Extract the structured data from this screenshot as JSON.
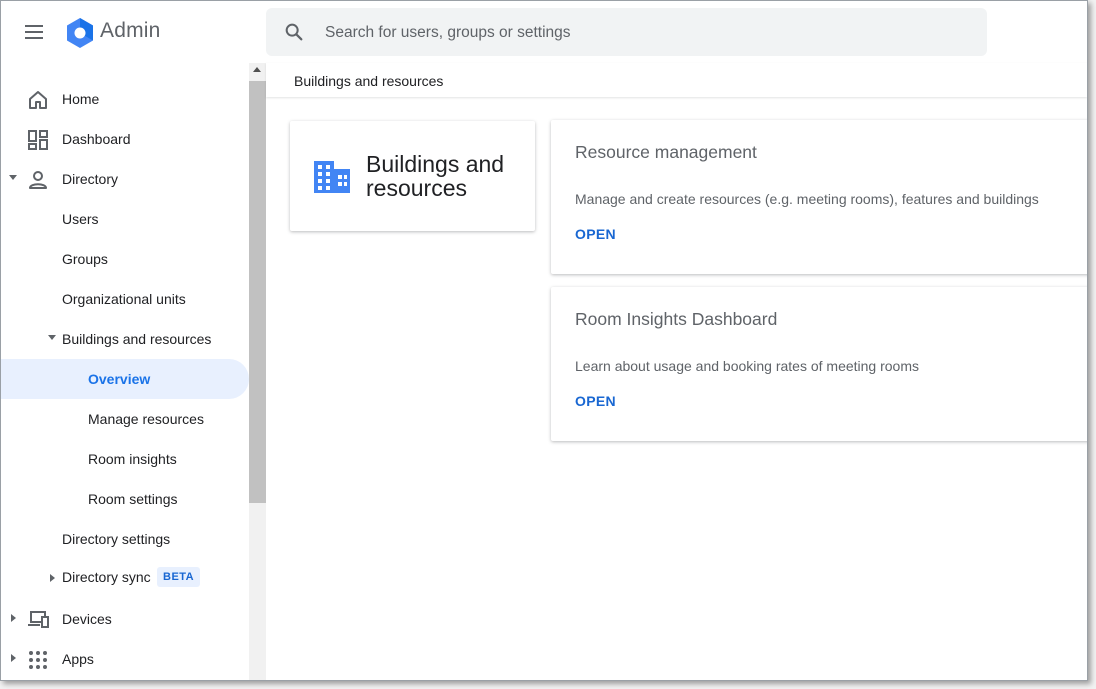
{
  "header": {
    "app_title": "Admin",
    "search_placeholder": "Search for users, groups or settings"
  },
  "sidebar": {
    "items": [
      {
        "label": "Home",
        "icon": "home-icon"
      },
      {
        "label": "Dashboard",
        "icon": "dashboard-icon"
      },
      {
        "label": "Directory",
        "icon": "person-icon"
      },
      {
        "label": "Users"
      },
      {
        "label": "Groups"
      },
      {
        "label": "Organizational units"
      },
      {
        "label": "Buildings and resources"
      },
      {
        "label": "Overview",
        "active": true
      },
      {
        "label": "Manage resources"
      },
      {
        "label": "Room insights"
      },
      {
        "label": "Room settings"
      },
      {
        "label": "Directory settings"
      },
      {
        "label": "Directory sync",
        "badge": "BETA"
      },
      {
        "label": "Devices",
        "icon": "devices-icon"
      },
      {
        "label": "Apps",
        "icon": "apps-grid-icon"
      }
    ]
  },
  "main": {
    "breadcrumb": "Buildings and resources",
    "title_card": {
      "title": "Buildings and resources",
      "icon": "building-icon"
    },
    "cards": [
      {
        "title": "Resource management",
        "description": "Manage and create resources (e.g. meeting rooms), features and buildings",
        "action": "OPEN"
      },
      {
        "title": "Room Insights Dashboard",
        "description": "Learn about usage and booking rates of meeting rooms",
        "action": "OPEN"
      }
    ]
  },
  "colors": {
    "accent": "#1a73e8",
    "active_bg": "#e8f0fe",
    "link": "#1967d2"
  }
}
